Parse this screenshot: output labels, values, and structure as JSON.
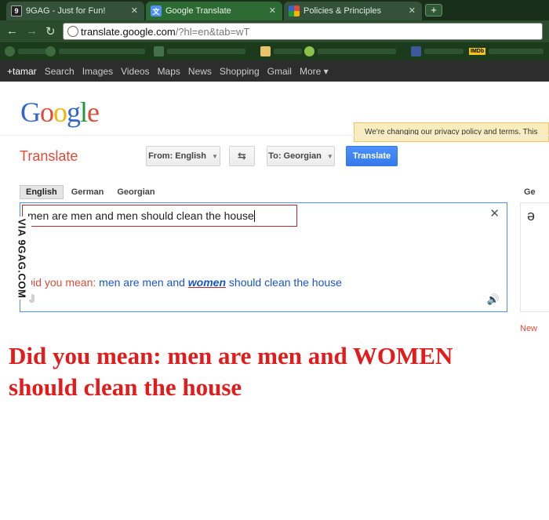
{
  "browser": {
    "tabs": [
      {
        "title": "9GAG - Just for Fun!",
        "favicon": "9gag-icon",
        "active": false
      },
      {
        "title": "Google Translate",
        "favicon": "google-translate-icon",
        "active": true
      },
      {
        "title": "Policies & Principles",
        "favicon": "google-icon",
        "active": false
      }
    ],
    "newtab_label": "+",
    "url_host": "translate.google.com",
    "url_path": "/?hl=en&tab=wT",
    "bookmark_icons": [
      "bookmark-icon",
      "bookmark-icon",
      "folder-icon",
      "android-icon",
      "facebook-icon",
      "imdb-icon"
    ],
    "imdb_label": "IMDb"
  },
  "gbar": {
    "items": [
      "+tamar",
      "Search",
      "Images",
      "Videos",
      "Maps",
      "News",
      "Shopping",
      "Gmail",
      "More ▾"
    ]
  },
  "header": {
    "logo_letters": [
      {
        "ch": "G",
        "color": "#3366cc"
      },
      {
        "ch": "o",
        "color": "#dd4b39"
      },
      {
        "ch": "o",
        "color": "#f5b400"
      },
      {
        "ch": "g",
        "color": "#3366cc"
      },
      {
        "ch": "l",
        "color": "#1c9a3a"
      },
      {
        "ch": "e",
        "color": "#dd4b39"
      }
    ],
    "notice": "We're changing our privacy policy and terms. This"
  },
  "translate": {
    "title": "Translate",
    "from_label": "From: English",
    "swap_icon": "swap-icon",
    "to_label": "To: Georgian",
    "translate_button": "Translate",
    "source_tabs": [
      "English",
      "German",
      "Georgian"
    ],
    "input_text": "men are men and men should clean the house",
    "did_you_mean_prefix": "Did you mean:",
    "suggestion_before": "men are men and",
    "suggestion_highlight": "women",
    "suggestion_after": "should clean the house",
    "output_lang_partial": "Ge",
    "output_glyph": "ə",
    "new_link_partial": "New"
  },
  "watermark": "VIA 9GAG.COM",
  "caption": {
    "line1": "Did you mean: men are men and WOMEN",
    "line2": "should clean the house"
  }
}
